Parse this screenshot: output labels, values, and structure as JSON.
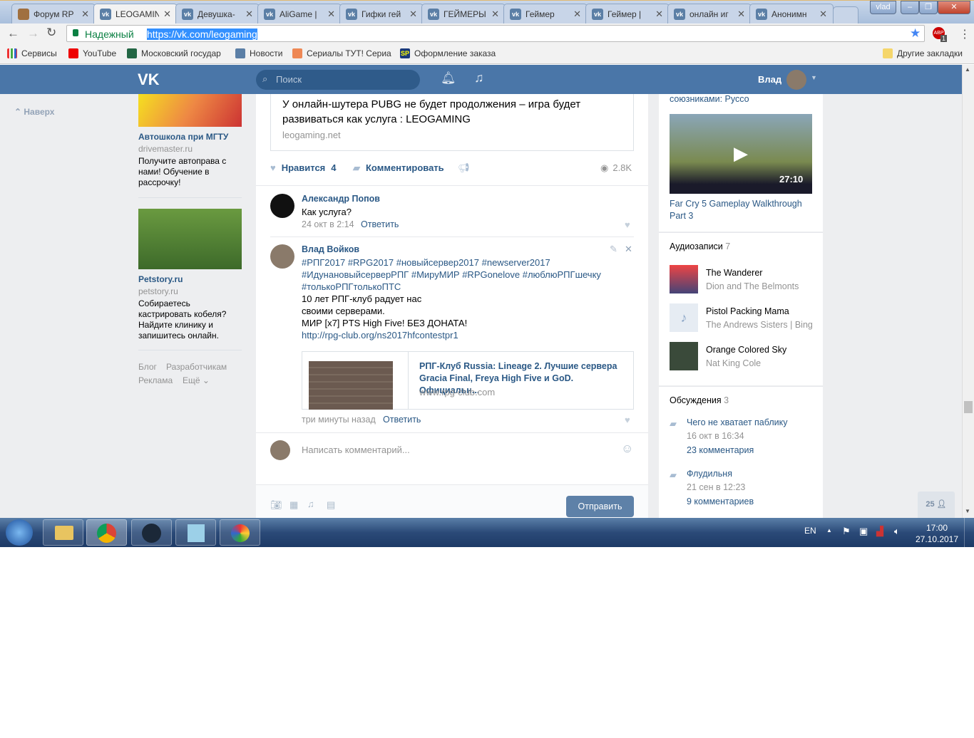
{
  "browser": {
    "tabs": [
      {
        "label": "Форум RP",
        "active": false
      },
      {
        "label": "LEOGAMING",
        "active": true
      },
      {
        "label": "Девушка-",
        "active": false
      },
      {
        "label": "AliGame |",
        "active": false
      },
      {
        "label": "Гифки гей",
        "active": false
      },
      {
        "label": "ГЕЙМЕРЫ",
        "active": false
      },
      {
        "label": "Геймер",
        "active": false
      },
      {
        "label": "Геймер |",
        "active": false
      },
      {
        "label": "онлайн иг",
        "active": false
      },
      {
        "label": "Анонимн",
        "active": false
      }
    ],
    "user_badge": "vlad",
    "secure_label": "Надежный",
    "url": "https://vk.com/leogaming",
    "abp_count": "1",
    "bookmarks": [
      "Сервисы",
      "YouTube",
      "Московский государ",
      "Новости",
      "Сериалы ТУТ! Сериа",
      "Оформление заказа"
    ],
    "other_bookmarks": "Другие закладки"
  },
  "vk": {
    "search_placeholder": "Поиск",
    "user_name": "Влад",
    "back_to_top": "Наверх",
    "ads": [
      {
        "title": "Автошкола при МГТУ",
        "domain": "drivemaster.ru",
        "text": "Получите автоправа с нами! Обучение в рассрочку!"
      },
      {
        "title": "Petstory.ru",
        "domain": "petstory.ru",
        "text": "Собираетесь кастрировать кобеля? Найдите клинику и запишитесь онлайн."
      }
    ],
    "footer_links": [
      "Блог",
      "Разработчикам",
      "Реклама",
      "Ещё"
    ],
    "post": {
      "link_title": "У онлайн-шутера PUBG не будет продолжения – игра будет развиваться как услуга : LEOGAMING",
      "link_domain": "leogaming.net",
      "like_label": "Нравится",
      "like_count": "4",
      "comment_label": "Комментировать",
      "views": "2.8K"
    },
    "comments": [
      {
        "author": "Александр Попов",
        "text": "Как услуга?",
        "time": "24 окт в 2:14",
        "reply": "Ответить"
      },
      {
        "author": "Влад Войков",
        "hashtags": "#РПГ2017 #RPG2017 #новыйсервер2017 #newserver2017 #ИдунановыйсерверРПГ #МируМИР #RPGonelove #люблюРПГшечку #толькоРПГтолькоПТС",
        "lines": [
          "10 лет РПГ-клуб радует нас",
          "своими серверами.",
          "МИР [x7] PTS High Five! БЕЗ ДОНАТА!"
        ],
        "url": "http://rpg-club.org/ns2017hfcontestpr1",
        "attach_title": "РПГ-Клуб Russia: Lineage 2. Лучшие сервера Gracia Final, Freya High Five и GoD. Официальн...",
        "attach_domain": "www.rpg-club.com",
        "time": "три минуты назад",
        "reply": "Ответить"
      }
    ],
    "comment_placeholder": "Написать комментарий...",
    "send_label": "Отправить",
    "right": {
      "video_caption_top": "союзниками: Руссо",
      "video_duration": "27:10",
      "video_title": "Far Cry 5 Gameplay Walkthrough Part 3",
      "audio_header": "Аудиозаписи",
      "audio_count": "7",
      "audio": [
        {
          "title": "The Wanderer",
          "artist": "Dion and The Belmonts"
        },
        {
          "title": "Pistol Packing Mama",
          "artist": "The Andrews Sisters | Bing"
        },
        {
          "title": "Orange Colored Sky",
          "artist": "Nat King Cole"
        }
      ],
      "disc_header": "Обсуждения",
      "disc_count": "3",
      "discussions": [
        {
          "title": "Чего не хватает паблику",
          "date": "16 окт в 16:34",
          "comments": "23 комментария"
        },
        {
          "title": "Флудильня",
          "date": "21 сен в 12:23",
          "comments": "9 комментариев"
        }
      ],
      "online_count": "25"
    }
  },
  "taskbar": {
    "lang": "EN",
    "time": "17:00",
    "date": "27.10.2017"
  }
}
